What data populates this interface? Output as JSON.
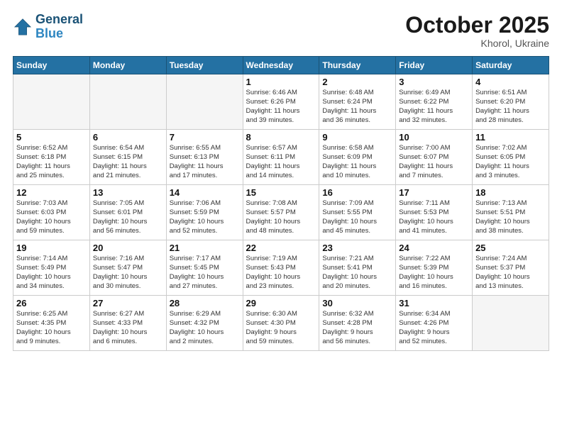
{
  "header": {
    "logo_line1": "General",
    "logo_line2": "Blue",
    "month": "October 2025",
    "location": "Khorol, Ukraine"
  },
  "weekdays": [
    "Sunday",
    "Monday",
    "Tuesday",
    "Wednesday",
    "Thursday",
    "Friday",
    "Saturday"
  ],
  "weeks": [
    [
      {
        "day": "",
        "info": ""
      },
      {
        "day": "",
        "info": ""
      },
      {
        "day": "",
        "info": ""
      },
      {
        "day": "1",
        "info": "Sunrise: 6:46 AM\nSunset: 6:26 PM\nDaylight: 11 hours\nand 39 minutes."
      },
      {
        "day": "2",
        "info": "Sunrise: 6:48 AM\nSunset: 6:24 PM\nDaylight: 11 hours\nand 36 minutes."
      },
      {
        "day": "3",
        "info": "Sunrise: 6:49 AM\nSunset: 6:22 PM\nDaylight: 11 hours\nand 32 minutes."
      },
      {
        "day": "4",
        "info": "Sunrise: 6:51 AM\nSunset: 6:20 PM\nDaylight: 11 hours\nand 28 minutes."
      }
    ],
    [
      {
        "day": "5",
        "info": "Sunrise: 6:52 AM\nSunset: 6:18 PM\nDaylight: 11 hours\nand 25 minutes."
      },
      {
        "day": "6",
        "info": "Sunrise: 6:54 AM\nSunset: 6:15 PM\nDaylight: 11 hours\nand 21 minutes."
      },
      {
        "day": "7",
        "info": "Sunrise: 6:55 AM\nSunset: 6:13 PM\nDaylight: 11 hours\nand 17 minutes."
      },
      {
        "day": "8",
        "info": "Sunrise: 6:57 AM\nSunset: 6:11 PM\nDaylight: 11 hours\nand 14 minutes."
      },
      {
        "day": "9",
        "info": "Sunrise: 6:58 AM\nSunset: 6:09 PM\nDaylight: 11 hours\nand 10 minutes."
      },
      {
        "day": "10",
        "info": "Sunrise: 7:00 AM\nSunset: 6:07 PM\nDaylight: 11 hours\nand 7 minutes."
      },
      {
        "day": "11",
        "info": "Sunrise: 7:02 AM\nSunset: 6:05 PM\nDaylight: 11 hours\nand 3 minutes."
      }
    ],
    [
      {
        "day": "12",
        "info": "Sunrise: 7:03 AM\nSunset: 6:03 PM\nDaylight: 10 hours\nand 59 minutes."
      },
      {
        "day": "13",
        "info": "Sunrise: 7:05 AM\nSunset: 6:01 PM\nDaylight: 10 hours\nand 56 minutes."
      },
      {
        "day": "14",
        "info": "Sunrise: 7:06 AM\nSunset: 5:59 PM\nDaylight: 10 hours\nand 52 minutes."
      },
      {
        "day": "15",
        "info": "Sunrise: 7:08 AM\nSunset: 5:57 PM\nDaylight: 10 hours\nand 48 minutes."
      },
      {
        "day": "16",
        "info": "Sunrise: 7:09 AM\nSunset: 5:55 PM\nDaylight: 10 hours\nand 45 minutes."
      },
      {
        "day": "17",
        "info": "Sunrise: 7:11 AM\nSunset: 5:53 PM\nDaylight: 10 hours\nand 41 minutes."
      },
      {
        "day": "18",
        "info": "Sunrise: 7:13 AM\nSunset: 5:51 PM\nDaylight: 10 hours\nand 38 minutes."
      }
    ],
    [
      {
        "day": "19",
        "info": "Sunrise: 7:14 AM\nSunset: 5:49 PM\nDaylight: 10 hours\nand 34 minutes."
      },
      {
        "day": "20",
        "info": "Sunrise: 7:16 AM\nSunset: 5:47 PM\nDaylight: 10 hours\nand 30 minutes."
      },
      {
        "day": "21",
        "info": "Sunrise: 7:17 AM\nSunset: 5:45 PM\nDaylight: 10 hours\nand 27 minutes."
      },
      {
        "day": "22",
        "info": "Sunrise: 7:19 AM\nSunset: 5:43 PM\nDaylight: 10 hours\nand 23 minutes."
      },
      {
        "day": "23",
        "info": "Sunrise: 7:21 AM\nSunset: 5:41 PM\nDaylight: 10 hours\nand 20 minutes."
      },
      {
        "day": "24",
        "info": "Sunrise: 7:22 AM\nSunset: 5:39 PM\nDaylight: 10 hours\nand 16 minutes."
      },
      {
        "day": "25",
        "info": "Sunrise: 7:24 AM\nSunset: 5:37 PM\nDaylight: 10 hours\nand 13 minutes."
      }
    ],
    [
      {
        "day": "26",
        "info": "Sunrise: 6:25 AM\nSunset: 4:35 PM\nDaylight: 10 hours\nand 9 minutes."
      },
      {
        "day": "27",
        "info": "Sunrise: 6:27 AM\nSunset: 4:33 PM\nDaylight: 10 hours\nand 6 minutes."
      },
      {
        "day": "28",
        "info": "Sunrise: 6:29 AM\nSunset: 4:32 PM\nDaylight: 10 hours\nand 2 minutes."
      },
      {
        "day": "29",
        "info": "Sunrise: 6:30 AM\nSunset: 4:30 PM\nDaylight: 9 hours\nand 59 minutes."
      },
      {
        "day": "30",
        "info": "Sunrise: 6:32 AM\nSunset: 4:28 PM\nDaylight: 9 hours\nand 56 minutes."
      },
      {
        "day": "31",
        "info": "Sunrise: 6:34 AM\nSunset: 4:26 PM\nDaylight: 9 hours\nand 52 minutes."
      },
      {
        "day": "",
        "info": ""
      }
    ]
  ]
}
